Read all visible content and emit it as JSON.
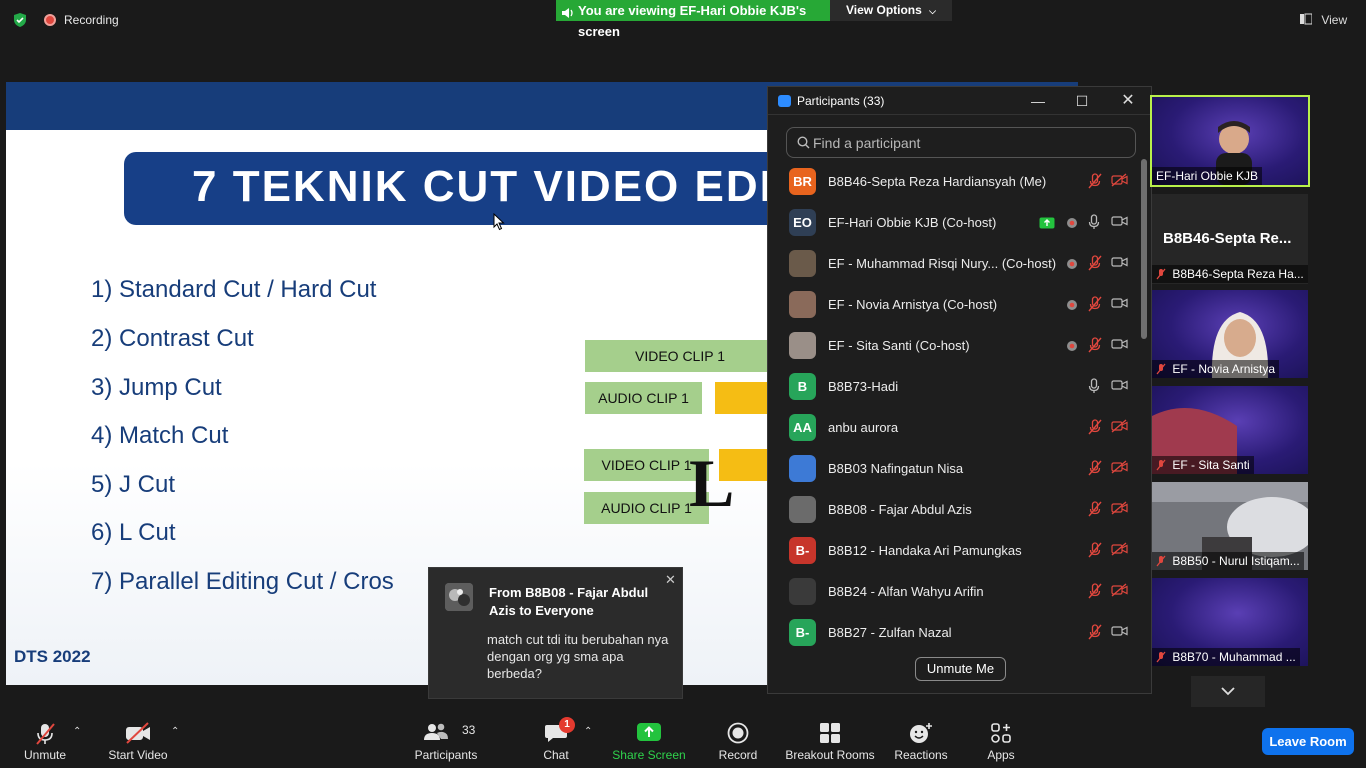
{
  "topbar": {
    "recording_label": "Recording",
    "viewing_text": "You are viewing EF-Hari Obbie KJB's screen",
    "view_options_label": "View Options",
    "view_label": "View"
  },
  "slide": {
    "title": "7 TEKNIK CUT VIDEO EDI",
    "items": [
      "1) Standard Cut / Hard Cut",
      "2) Contrast Cut",
      "3) Jump Cut",
      "4) Match Cut",
      "5) J Cut",
      "6) L Cut",
      "7) Parallel Editing Cut / Cros"
    ],
    "clips": {
      "video1_top": "VIDEO CLIP 1",
      "audio1_top": "AUDIO CLIP 1",
      "video1_bottom": "VIDEO CLIP 1",
      "audio1_bottom": "AUDIO CLIP 1",
      "big_letter": "L"
    },
    "footer": "DTS 2022"
  },
  "chat_popup": {
    "from": "From B8B08 - Fajar Abdul Azis to Everyone",
    "message": "match cut tdi  itu berubahan nya dengan org yg sma apa berbeda?",
    "close_icon": "close-icon"
  },
  "participants_panel": {
    "title": "Participants (33)",
    "search_placeholder": "Find a participant",
    "unmute_me_label": "Unmute Me",
    "participants": [
      {
        "initials": "BR",
        "name": "B8B46-Septa Reza Hardiansyah (Me)",
        "avatar_color": "#e8641e",
        "mic": "muted",
        "video": "off",
        "record": false,
        "share": false
      },
      {
        "initials": "EO",
        "name": "EF-Hari Obbie KJB (Co-host)",
        "avatar_color": "#2f3f55",
        "mic": "on",
        "video": "on",
        "record": true,
        "share": true
      },
      {
        "initials": "",
        "name": "EF - Muhammad Risqi Nury...  (Co-host)",
        "avatar_color": "#6a5a4a",
        "mic": "muted",
        "video": "on",
        "record": true,
        "share": false
      },
      {
        "initials": "",
        "name": "EF - Novia Arnistya (Co-host)",
        "avatar_color": "#8a6a5a",
        "mic": "muted",
        "video": "on",
        "record": true,
        "share": false
      },
      {
        "initials": "",
        "name": "EF - Sita Santi (Co-host)",
        "avatar_color": "#9a8f88",
        "mic": "muted",
        "video": "on",
        "record": true,
        "share": false
      },
      {
        "initials": "B",
        "name": "B8B73-Hadi",
        "avatar_color": "#27a55a",
        "mic": "on",
        "video": "on",
        "record": false,
        "share": false
      },
      {
        "initials": "AA",
        "name": "anbu aurora",
        "avatar_color": "#27a55a",
        "mic": "muted",
        "video": "off",
        "record": false,
        "share": false
      },
      {
        "initials": "",
        "name": "B8B03 Nafingatun Nisa",
        "avatar_color": "#3d7ad6",
        "mic": "muted",
        "video": "off",
        "record": false,
        "share": false
      },
      {
        "initials": "",
        "name": "B8B08 - Fajar Abdul Azis",
        "avatar_color": "#6b6b6b",
        "mic": "muted",
        "video": "off",
        "record": false,
        "share": false
      },
      {
        "initials": "B-",
        "name": "B8B12 - Handaka Ari Pamungkas",
        "avatar_color": "#c7352b",
        "mic": "muted",
        "video": "off",
        "record": false,
        "share": false
      },
      {
        "initials": "",
        "name": "B8B24 - Alfan Wahyu Arifin",
        "avatar_color": "#3a3a3a",
        "mic": "muted",
        "video": "off",
        "record": false,
        "share": false
      },
      {
        "initials": "B-",
        "name": "B8B27 - Zulfan Nazal",
        "avatar_color": "#27a55a",
        "mic": "muted",
        "video": "on",
        "record": false,
        "share": false
      }
    ]
  },
  "video_strip": {
    "tiles": [
      {
        "name": "EF-Hari Obbie KJB",
        "muted": false,
        "active": true
      },
      {
        "name": "B8B46-Septa Reza Ha...",
        "muted": true,
        "big_name": "B8B46-Septa Re..."
      },
      {
        "name": "EF - Novia Arnistya",
        "muted": true
      },
      {
        "name": "EF - Sita Santi",
        "muted": true
      },
      {
        "name": "B8B50 - Nurul Istiqam...",
        "muted": true
      },
      {
        "name": "B8B70 - Muhammad ...",
        "muted": true
      }
    ]
  },
  "toolbar": {
    "unmute_label": "Unmute",
    "start_video_label": "Start Video",
    "participants_label": "Participants",
    "participants_count": "33",
    "chat_label": "Chat",
    "chat_badge": "1",
    "share_screen_label": "Share Screen",
    "record_label": "Record",
    "breakout_label": "Breakout Rooms",
    "reactions_label": "Reactions",
    "apps_label": "Apps",
    "leave_label": "Leave Room"
  },
  "colors": {
    "accent_blue": "#0e72ed",
    "share_green": "#27a836",
    "slide_blue": "#173d7a",
    "mute_red": "#e0473e"
  }
}
